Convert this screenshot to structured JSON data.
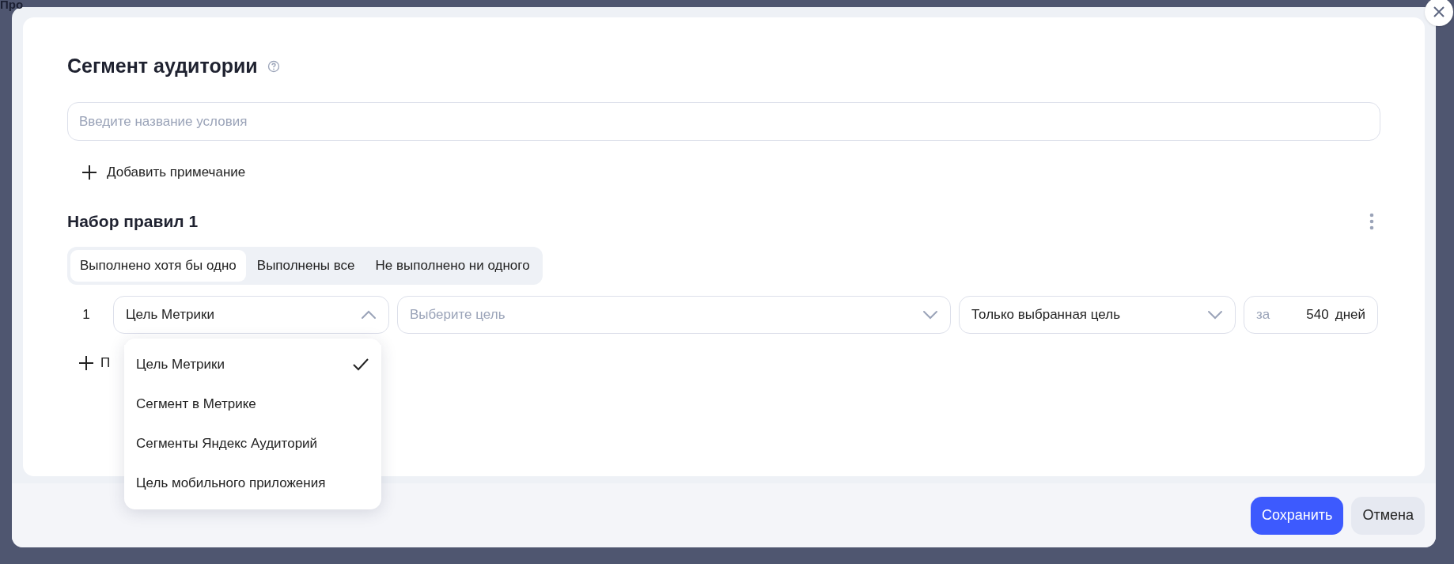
{
  "background": {
    "fragment": "Про"
  },
  "dialog": {
    "title": "Сегмент аудитории",
    "name_field": {
      "placeholder": "Введите название условия"
    },
    "add_note": "Добавить примечание",
    "rule_set": {
      "title": "Набор правил 1",
      "modes": [
        {
          "label": "Выполнено хотя бы одно",
          "selected": true
        },
        {
          "label": "Выполнены все",
          "selected": false
        },
        {
          "label": "Не выполнено ни одного",
          "selected": false
        }
      ],
      "conditions": [
        {
          "number": "1",
          "type": {
            "value": "Цель Метрики",
            "expanded": true,
            "options": [
              {
                "label": "Цель Метрики",
                "selected": true
              },
              {
                "label": "Сегмент в Метрике",
                "selected": false
              },
              {
                "label": "Сегменты Яндекс Аудиторий",
                "selected": false
              },
              {
                "label": "Цель мобильного приложения",
                "selected": false
              }
            ]
          },
          "goal": {
            "placeholder": "Выберите цель"
          },
          "scope": {
            "value": "Только выбранная цель"
          },
          "period": {
            "prefix": "за",
            "value": "540",
            "unit": "дней"
          }
        }
      ],
      "add_condition": "П"
    },
    "buttons": [
      {
        "label": "Сохранить",
        "kind": "primary"
      },
      {
        "label": "Отмена",
        "kind": "secondary"
      }
    ]
  }
}
